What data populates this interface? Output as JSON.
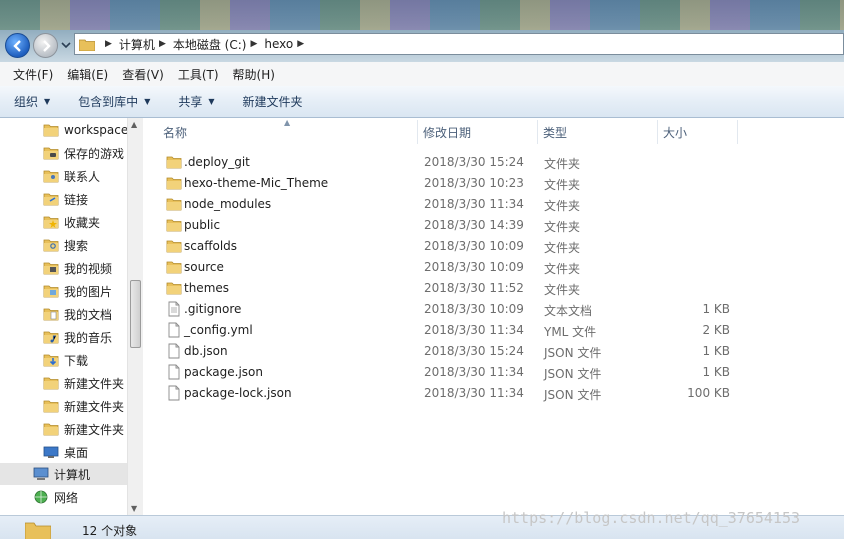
{
  "address": {
    "crumbs": [
      "计算机",
      "本地磁盘 (C:)",
      "hexo"
    ]
  },
  "menu": [
    "文件(F)",
    "编辑(E)",
    "查看(V)",
    "工具(T)",
    "帮助(H)"
  ],
  "toolbar": {
    "organize": "组织",
    "include_library": "包含到库中",
    "share": "共享",
    "new_folder": "新建文件夹"
  },
  "nav": [
    {
      "label": "workspace",
      "icon": "folder-icon"
    },
    {
      "label": "保存的游戏",
      "icon": "saved-games-icon"
    },
    {
      "label": "联系人",
      "icon": "contacts-icon"
    },
    {
      "label": "链接",
      "icon": "links-icon"
    },
    {
      "label": "收藏夹",
      "icon": "favorites-icon"
    },
    {
      "label": "搜索",
      "icon": "searches-icon"
    },
    {
      "label": "我的视频",
      "icon": "videos-icon"
    },
    {
      "label": "我的图片",
      "icon": "pictures-icon"
    },
    {
      "label": "我的文档",
      "icon": "documents-icon"
    },
    {
      "label": "我的音乐",
      "icon": "music-icon"
    },
    {
      "label": "下载",
      "icon": "downloads-icon"
    },
    {
      "label": "新建文件夹",
      "icon": "folder-icon"
    },
    {
      "label": "新建文件夹",
      "icon": "folder-icon"
    },
    {
      "label": "新建文件夹",
      "icon": "folder-icon"
    },
    {
      "label": "桌面",
      "icon": "desktop-icon"
    },
    {
      "label": "计算机",
      "icon": "computer-icon"
    },
    {
      "label": "网络",
      "icon": "network-icon"
    }
  ],
  "columns": {
    "name": "名称",
    "date": "修改日期",
    "type": "类型",
    "size": "大小"
  },
  "files": [
    {
      "name": ".deploy_git",
      "date": "2018/3/30 15:24",
      "type": "文件夹",
      "size": "",
      "icon": "folder-icon"
    },
    {
      "name": "hexo-theme-Mic_Theme",
      "date": "2018/3/30 10:23",
      "type": "文件夹",
      "size": "",
      "icon": "folder-icon"
    },
    {
      "name": "node_modules",
      "date": "2018/3/30 11:34",
      "type": "文件夹",
      "size": "",
      "icon": "folder-icon"
    },
    {
      "name": "public",
      "date": "2018/3/30 14:39",
      "type": "文件夹",
      "size": "",
      "icon": "folder-icon"
    },
    {
      "name": "scaffolds",
      "date": "2018/3/30 10:09",
      "type": "文件夹",
      "size": "",
      "icon": "folder-icon"
    },
    {
      "name": "source",
      "date": "2018/3/30 10:09",
      "type": "文件夹",
      "size": "",
      "icon": "folder-icon"
    },
    {
      "name": "themes",
      "date": "2018/3/30 11:52",
      "type": "文件夹",
      "size": "",
      "icon": "folder-icon"
    },
    {
      "name": ".gitignore",
      "date": "2018/3/30 10:09",
      "type": "文本文档",
      "size": "1 KB",
      "icon": "text-file-icon"
    },
    {
      "name": "_config.yml",
      "date": "2018/3/30 11:34",
      "type": "YML 文件",
      "size": "2 KB",
      "icon": "file-icon"
    },
    {
      "name": "db.json",
      "date": "2018/3/30 15:24",
      "type": "JSON 文件",
      "size": "1 KB",
      "icon": "file-icon"
    },
    {
      "name": "package.json",
      "date": "2018/3/30 11:34",
      "type": "JSON 文件",
      "size": "1 KB",
      "icon": "file-icon"
    },
    {
      "name": "package-lock.json",
      "date": "2018/3/30 11:34",
      "type": "JSON 文件",
      "size": "100 KB",
      "icon": "file-icon"
    }
  ],
  "status": {
    "count": "12 个对象"
  },
  "watermark": "https://blog.csdn.net/qq_37654153",
  "colors": {
    "folder": "#e8c05a",
    "selection": "#e5e5e5",
    "toolbar": "#dae6f2"
  }
}
